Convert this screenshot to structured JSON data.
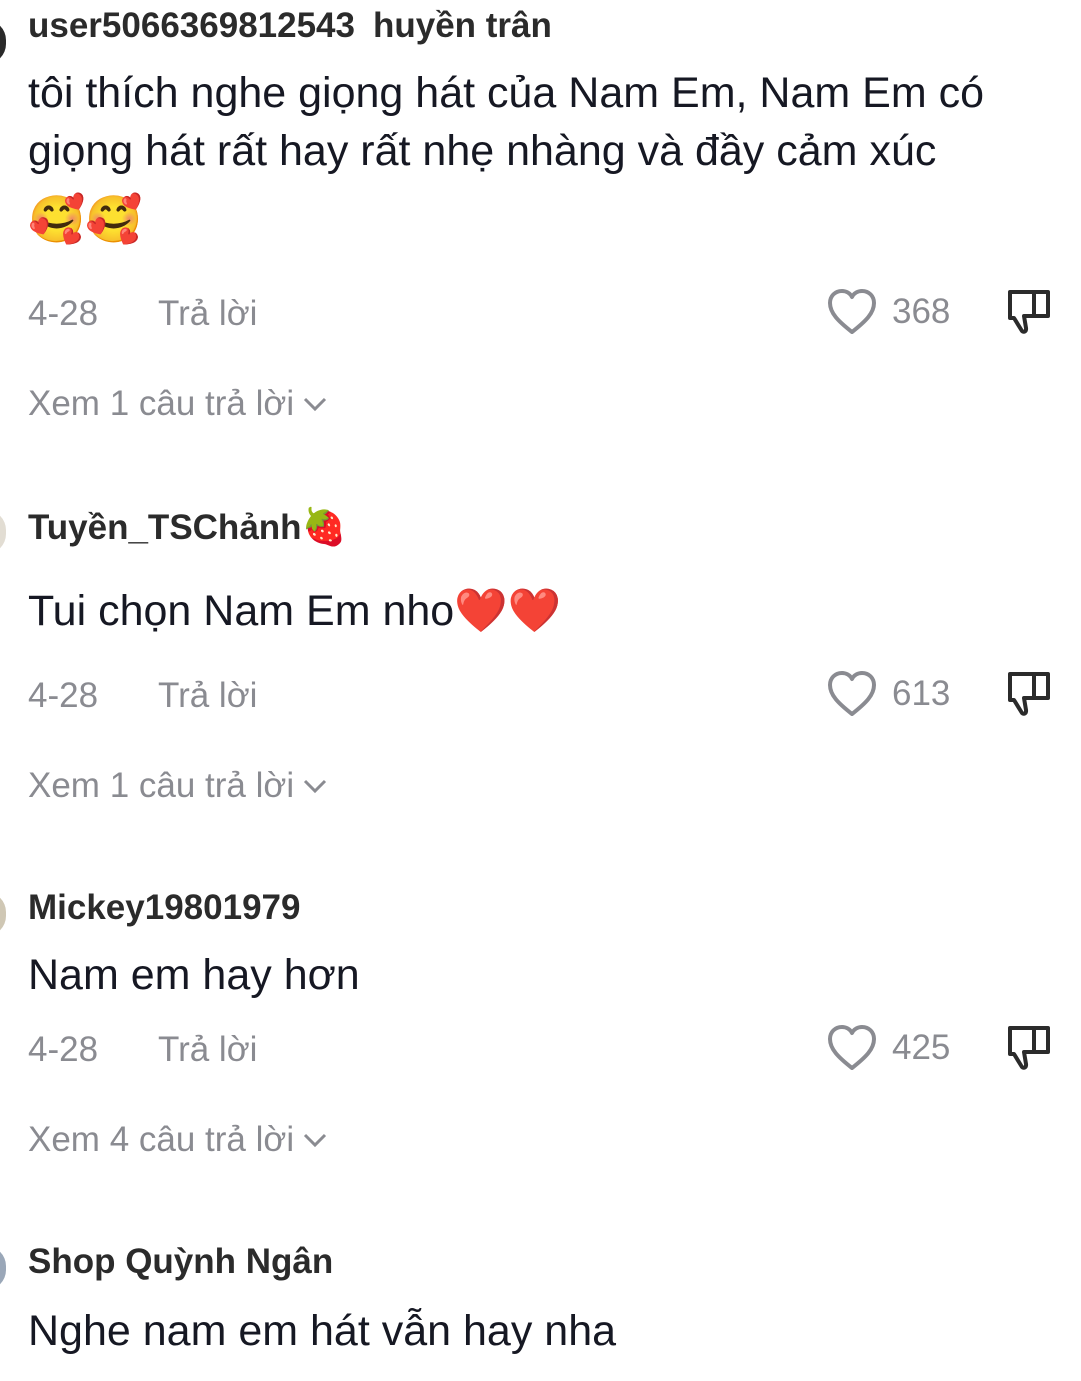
{
  "comments": [
    {
      "username": "user5066369812543",
      "display_name": "huyền trân",
      "text": "tôi thích nghe giọng hát của Nam Em, Nam Em có giọng hát rất hay rất nhẹ nhàng và đầy cảm xúc",
      "emoji": "🥰🥰",
      "date": "4-28",
      "reply_label": "Trả lời",
      "likes": "368",
      "view_replies": "Xem 1 câu trả lời"
    },
    {
      "username": "Tuyền_TSChảnh",
      "username_emoji": "🍓",
      "text": "Tui chọn Nam Em nho",
      "text_emoji": "❤️❤️",
      "date": "4-28",
      "reply_label": "Trả lời",
      "likes": "613",
      "view_replies": "Xem 1 câu trả lời"
    },
    {
      "username": "Mickey19801979",
      "text": "Nam em hay hơn",
      "date": "4-28",
      "reply_label": "Trả lời",
      "likes": "425",
      "view_replies": "Xem 4 câu trả lời"
    },
    {
      "username": "Shop Quỳnh Ngân",
      "text": "Nghe nam em hát vẫn hay nha"
    }
  ],
  "colors": {
    "primary_text": "#161823",
    "secondary_text": "#8a8b91",
    "heart": "#ff2d55"
  },
  "icons": {
    "like": "heart-outline-icon",
    "dislike": "thumbs-down-outline-icon",
    "expand": "chevron-down-icon"
  }
}
